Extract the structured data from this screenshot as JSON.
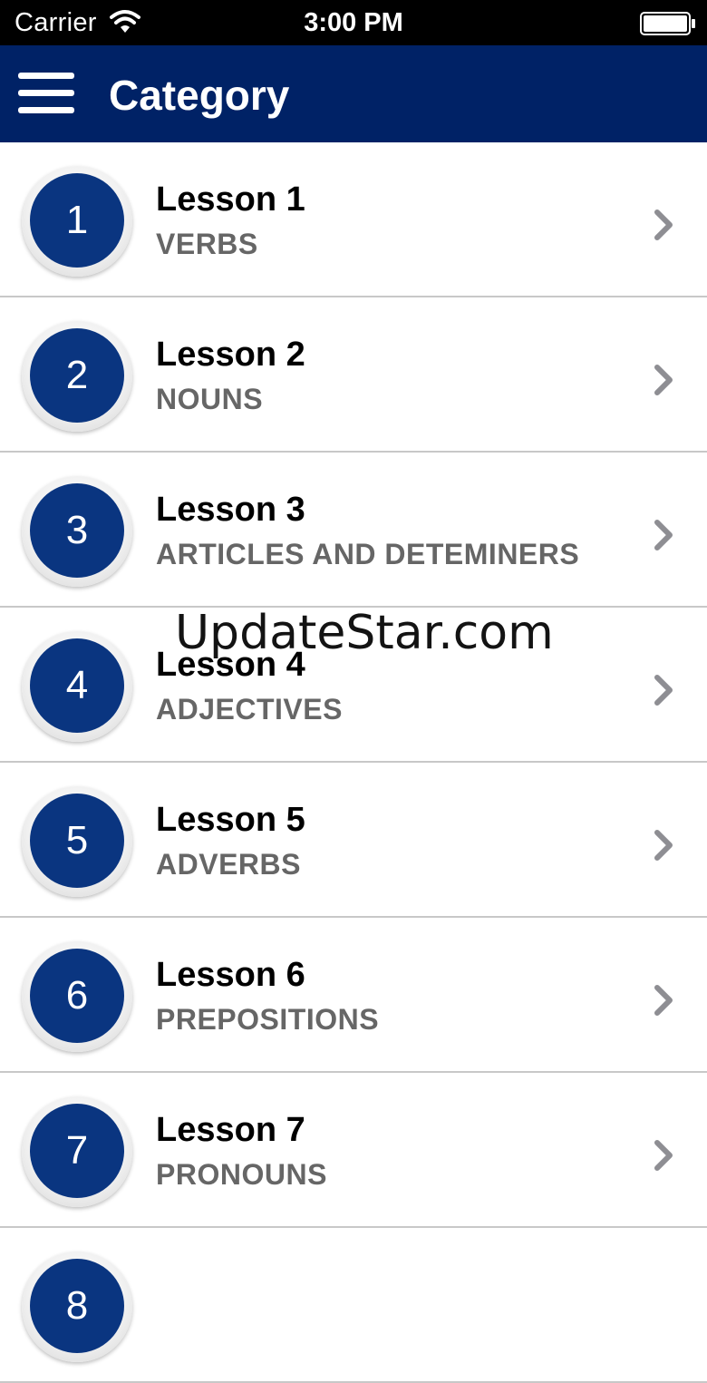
{
  "status_bar": {
    "carrier": "Carrier",
    "time": "3:00 PM",
    "wifi_icon": "wifi-icon",
    "battery_icon": "battery-full-icon"
  },
  "nav": {
    "title": "Category",
    "menu_icon": "hamburger-menu-icon",
    "background_color": "#002266"
  },
  "lessons": [
    {
      "number": "1",
      "title": "Lesson 1",
      "topic": "VERBS"
    },
    {
      "number": "2",
      "title": "Lesson 2",
      "topic": "NOUNS"
    },
    {
      "number": "3",
      "title": "Lesson 3",
      "topic": "ARTICLES AND DETEMINERS"
    },
    {
      "number": "4",
      "title": "Lesson 4",
      "topic": "ADJECTIVES"
    },
    {
      "number": "5",
      "title": "Lesson 5",
      "topic": "ADVERBS"
    },
    {
      "number": "6",
      "title": "Lesson 6",
      "topic": "PREPOSITIONS"
    },
    {
      "number": "7",
      "title": "Lesson 7",
      "topic": "PRONOUNS"
    },
    {
      "number": "8",
      "title": "",
      "topic": ""
    }
  ],
  "watermark": "UpdateStar.com",
  "colors": {
    "badge": "#0a3580",
    "subtitle": "#666666",
    "chevron": "#8e8e93"
  }
}
